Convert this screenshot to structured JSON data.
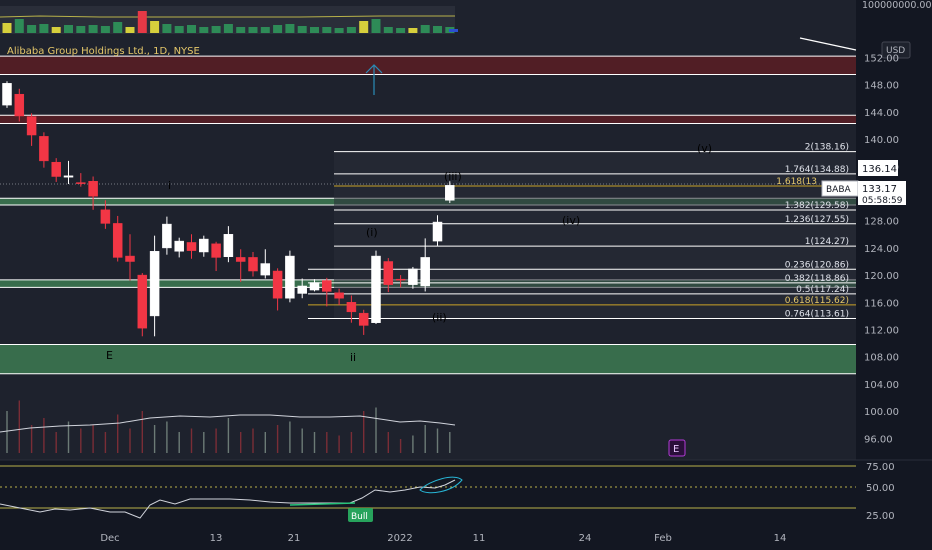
{
  "symbol": "Alibaba Group Holdings Ltd., 1D, NYSE",
  "currency": "USD",
  "price_axis": {
    "top_value": "100000000.00",
    "labels": [
      "152.00",
      "148.00",
      "144.00",
      "140.00",
      "136.00",
      "132.00",
      "128.00",
      "124.00",
      "120.00",
      "116.00",
      "112.00",
      "108.00",
      "104.00",
      "100.00",
      "96.00"
    ]
  },
  "last_price": {
    "ticker": "BABA",
    "price": "133.17",
    "countdown": "05:58:59",
    "marker": "136.14"
  },
  "oscillator_axis": [
    "75.00",
    "50.00",
    "25.00"
  ],
  "time_axis": [
    "Dec",
    "13",
    "21",
    "2022",
    "11",
    "24",
    "Feb",
    "14"
  ],
  "fib_levels": [
    {
      "label": "2(138.16)",
      "price": 138.16
    },
    {
      "label": "1.764(134.88)",
      "price": 134.88
    },
    {
      "label": "1.618(13",
      "price": 133.1
    },
    {
      "label": "1.382(129.58)",
      "price": 129.58
    },
    {
      "label": "1.236(127.55)",
      "price": 127.55
    },
    {
      "label": "1(124.27)",
      "price": 124.27
    },
    {
      "label": "0.236(120.86)",
      "price": 120.86
    },
    {
      "label": "0.382(118.86)",
      "price": 118.86
    },
    {
      "label": "0.5(117.24)",
      "price": 117.24
    },
    {
      "label": "0.618(115.62)",
      "price": 115.62
    },
    {
      "label": "0.764(113.61)",
      "price": 113.61
    }
  ],
  "zones": [
    {
      "color": "#5a1d24",
      "from": 149.5,
      "to": 152.2
    },
    {
      "color": "#5a1d24",
      "from": 142.3,
      "to": 143.5
    },
    {
      "color": "#3d7a52",
      "from": 130.3,
      "to": 131.3
    },
    {
      "color": "#3d7a52",
      "from": 118.2,
      "to": 119.3
    },
    {
      "color": "#3d7a52",
      "from": 105.5,
      "to": 109.8
    }
  ],
  "wave_labels": [
    {
      "text": "i",
      "color": "#ffffff"
    },
    {
      "text": "(i)",
      "color": "#e6d25a"
    },
    {
      "text": "(iii)",
      "color": "#e6d25a"
    },
    {
      "text": "(iv)",
      "color": "#e6d25a"
    },
    {
      "text": "(v)",
      "color": "#e6d25a"
    },
    {
      "text": "(ii)",
      "color": "#e6d25a"
    },
    {
      "text": "ii",
      "color": "#ffffff"
    },
    {
      "text": "E",
      "color": "#8fd4a0"
    }
  ],
  "badges": {
    "event": "E",
    "bull": "Bull"
  },
  "colors": {
    "background": "#131722",
    "up_candle": "#ffffff",
    "down_candle": "#f23645",
    "wick": "#787b86",
    "fib_line": "#ffffff",
    "gold_line": "#c9a227"
  },
  "candles": [
    {
      "d": 0,
      "o": 145.0,
      "h": 148.5,
      "c": 148.2,
      "l": 144.6
    },
    {
      "d": 1,
      "o": 146.6,
      "h": 147.4,
      "c": 143.4,
      "l": 142.6
    },
    {
      "d": 2,
      "o": 143.3,
      "h": 143.8,
      "c": 140.6,
      "l": 139.0
    },
    {
      "d": 3,
      "o": 140.4,
      "h": 141.0,
      "c": 136.8,
      "l": 135.8
    },
    {
      "d": 4,
      "o": 136.6,
      "h": 137.2,
      "c": 134.5,
      "l": 133.7
    },
    {
      "d": 5,
      "o": 134.4,
      "h": 136.8,
      "c": 134.6,
      "l": 133.4
    },
    {
      "d": 6,
      "o": 133.6,
      "h": 135.0,
      "c": 133.5,
      "l": 133.0
    },
    {
      "d": 7,
      "o": 133.8,
      "h": 134.5,
      "c": 131.6,
      "l": 129.6
    },
    {
      "d": 8,
      "o": 129.6,
      "h": 131.0,
      "c": 127.6,
      "l": 126.8
    },
    {
      "d": 9,
      "o": 127.6,
      "h": 128.7,
      "c": 122.6,
      "l": 122.0
    },
    {
      "d": 10,
      "o": 122.8,
      "h": 126.0,
      "c": 122.0,
      "l": 119.2
    },
    {
      "d": 11,
      "o": 120.0,
      "h": 120.3,
      "c": 112.2,
      "l": 111.0
    },
    {
      "d": 12,
      "o": 114.0,
      "h": 125.8,
      "c": 123.5,
      "l": 111.0
    },
    {
      "d": 13,
      "o": 124.0,
      "h": 128.6,
      "c": 127.5,
      "l": 123.0
    },
    {
      "d": 14,
      "o": 123.5,
      "h": 125.5,
      "c": 125.0,
      "l": 122.6
    },
    {
      "d": 15,
      "o": 124.8,
      "h": 126.0,
      "c": 123.6,
      "l": 122.4
    },
    {
      "d": 16,
      "o": 123.4,
      "h": 125.8,
      "c": 125.3,
      "l": 122.7
    },
    {
      "d": 17,
      "o": 124.6,
      "h": 124.9,
      "c": 122.6,
      "l": 120.6
    },
    {
      "d": 18,
      "o": 122.7,
      "h": 127.2,
      "c": 126.0,
      "l": 121.9
    },
    {
      "d": 19,
      "o": 122.6,
      "h": 123.8,
      "c": 122.0,
      "l": 119.0
    },
    {
      "d": 20,
      "o": 122.6,
      "h": 123.4,
      "c": 120.6,
      "l": 119.8
    },
    {
      "d": 21,
      "o": 120.0,
      "h": 123.8,
      "c": 121.7,
      "l": 119.5
    },
    {
      "d": 22,
      "o": 120.6,
      "h": 121.0,
      "c": 116.6,
      "l": 114.8
    },
    {
      "d": 23,
      "o": 116.6,
      "h": 123.6,
      "c": 122.8,
      "l": 116.0
    },
    {
      "d": 24,
      "o": 117.3,
      "h": 119.5,
      "c": 118.4,
      "l": 116.6
    },
    {
      "d": 25,
      "o": 117.8,
      "h": 119.4,
      "c": 118.9,
      "l": 117.6
    },
    {
      "d": 26,
      "o": 119.2,
      "h": 119.6,
      "c": 117.6,
      "l": 115.4
    },
    {
      "d": 27,
      "o": 117.4,
      "h": 118.0,
      "c": 116.6,
      "l": 115.6
    },
    {
      "d": 28,
      "o": 116.0,
      "h": 117.0,
      "c": 114.6,
      "l": 113.0
    },
    {
      "d": 29,
      "o": 114.4,
      "h": 114.9,
      "c": 112.6,
      "l": 111.2
    },
    {
      "d": 30,
      "o": 113.0,
      "h": 123.6,
      "c": 122.8,
      "l": 112.8
    },
    {
      "d": 31,
      "o": 122.0,
      "h": 122.5,
      "c": 118.6,
      "l": 117.5
    },
    {
      "d": 32,
      "o": 119.4,
      "h": 120.0,
      "c": 119.3,
      "l": 118.2
    },
    {
      "d": 33,
      "o": 118.6,
      "h": 121.2,
      "c": 120.9,
      "l": 118.0
    },
    {
      "d": 34,
      "o": 118.4,
      "h": 125.4,
      "c": 122.6,
      "l": 117.6
    },
    {
      "d": 35,
      "o": 125.0,
      "h": 128.8,
      "c": 127.8,
      "l": 124.3
    },
    {
      "d": 36,
      "o": 131.0,
      "h": 133.8,
      "c": 133.2,
      "l": 130.6
    }
  ]
}
